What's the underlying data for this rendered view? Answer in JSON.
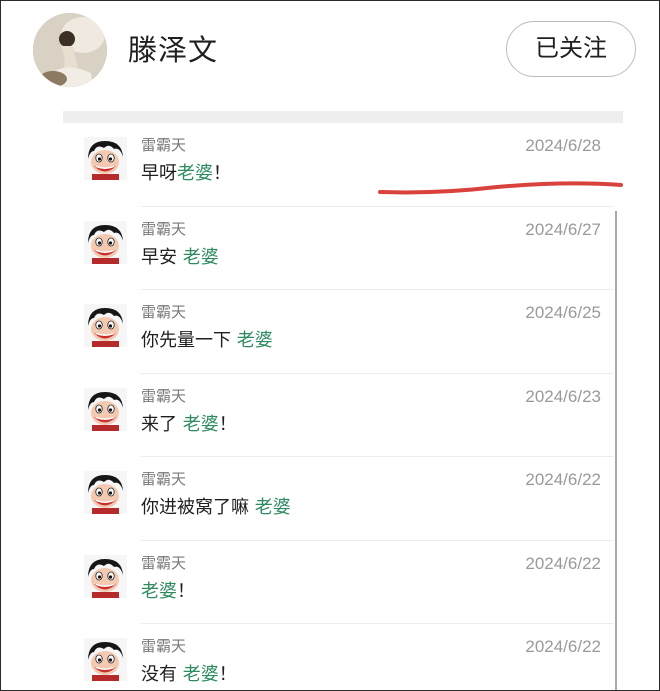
{
  "profile": {
    "name": "滕泽文",
    "follow_label": "已关注"
  },
  "colors": {
    "keyword": "#2e8b60",
    "highlight_stroke": "#d8413c"
  },
  "comments": [
    {
      "user": "雷霸天",
      "date": "2024/6/28",
      "prefix": "早呀",
      "keyword": "老婆",
      "suffix": "！"
    },
    {
      "user": "雷霸天",
      "date": "2024/6/27",
      "prefix": "早安 ",
      "keyword": "老婆",
      "suffix": ""
    },
    {
      "user": "雷霸天",
      "date": "2024/6/25",
      "prefix": "你先量一下 ",
      "keyword": "老婆",
      "suffix": ""
    },
    {
      "user": "雷霸天",
      "date": "2024/6/23",
      "prefix": "来了 ",
      "keyword": "老婆",
      "suffix": "！"
    },
    {
      "user": "雷霸天",
      "date": "2024/6/22",
      "prefix": "你进被窝了嘛 ",
      "keyword": "老婆",
      "suffix": ""
    },
    {
      "user": "雷霸天",
      "date": "2024/6/22",
      "prefix": "",
      "keyword": "老婆",
      "suffix": "！"
    },
    {
      "user": "雷霸天",
      "date": "2024/6/22",
      "prefix": "没有 ",
      "keyword": "老婆",
      "suffix": "！"
    }
  ]
}
